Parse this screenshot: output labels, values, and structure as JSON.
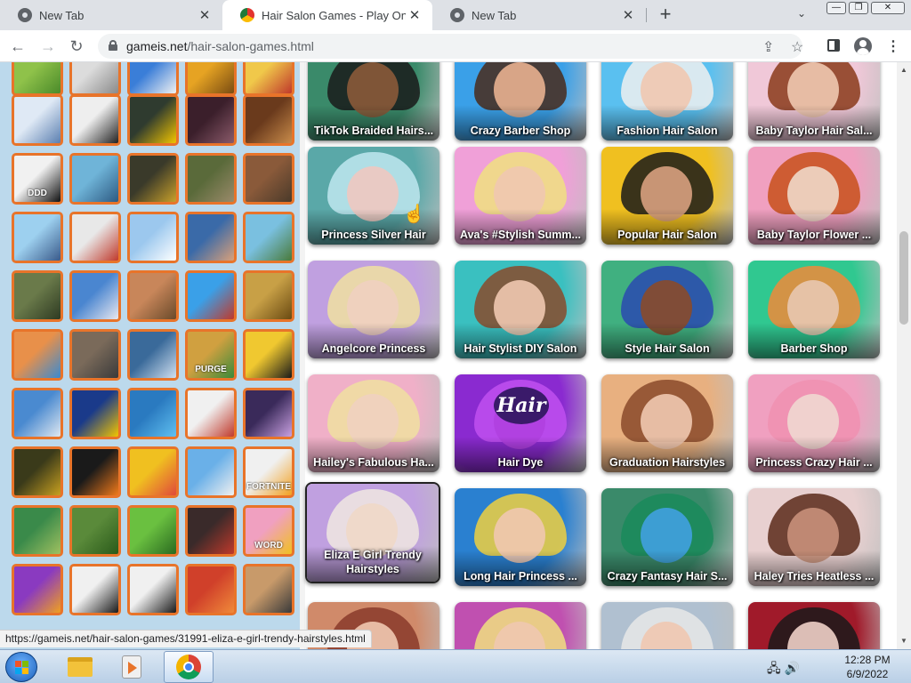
{
  "browser": {
    "tabs": [
      {
        "title": "New Tab",
        "icon": "chrome-icon"
      },
      {
        "title": "Hair Salon Games - Play Online",
        "icon": "hair-salon-favicon"
      },
      {
        "title": "New Tab",
        "icon": "chrome-icon"
      }
    ],
    "tab_close_glyph": "✕",
    "new_tab_glyph": "+",
    "tab_search_glyph": "⌄",
    "window_buttons": [
      "—",
      "❐",
      "✕"
    ],
    "nav": {
      "back": "←",
      "forward": "→",
      "reload": "↻"
    },
    "url_host": "gameis.net",
    "url_path": "/hair-salon-games.html",
    "share_glyph": "⇪",
    "star_glyph": "☆",
    "menu_glyph": "⋮"
  },
  "page": {
    "games": [
      {
        "label": "TikTok Braided Hairs..."
      },
      {
        "label": "Crazy Barber Shop"
      },
      {
        "label": "Fashion Hair Salon"
      },
      {
        "label": "Baby Taylor Hair Sal..."
      },
      {
        "label": "Princess Silver Hair"
      },
      {
        "label": "Ava's #Stylish Summ..."
      },
      {
        "label": "Popular Hair Salon"
      },
      {
        "label": "Baby Taylor Flower ..."
      },
      {
        "label": "Angelcore Princess"
      },
      {
        "label": "Hair Stylist DIY Salon"
      },
      {
        "label": "Style Hair Salon"
      },
      {
        "label": "Barber Shop"
      },
      {
        "label": "Hailey's Fabulous Ha..."
      },
      {
        "label": "Hair Dye"
      },
      {
        "label": "Graduation Hairstyles"
      },
      {
        "label": "Princess Crazy Hair ..."
      },
      {
        "label": "Eliza E Girl Trendy Hairstyles"
      },
      {
        "label": "Long Hair Princess ..."
      },
      {
        "label": "Crazy Fantasy Hair S..."
      },
      {
        "label": "Haley Tries Heatless ..."
      },
      {
        "label": ""
      },
      {
        "label": ""
      },
      {
        "label": ""
      },
      {
        "label": ""
      }
    ],
    "sidebar_tile_texts": [
      "DDD",
      "PURGE",
      "FORTNITE",
      "WORD"
    ],
    "hair_dye_logo": "Hair"
  },
  "status_url": "https://gameis.net/hair-salon-games/31991-eliza-e-girl-trendy-hairstyles.html",
  "taskbar": {
    "time": "12:28 PM",
    "date": "6/9/2022",
    "tray_glyphs": "🖧 🔊"
  },
  "colors": {
    "tile_border": "#e8742a",
    "sidebar_bg": "#bcd9ec"
  }
}
